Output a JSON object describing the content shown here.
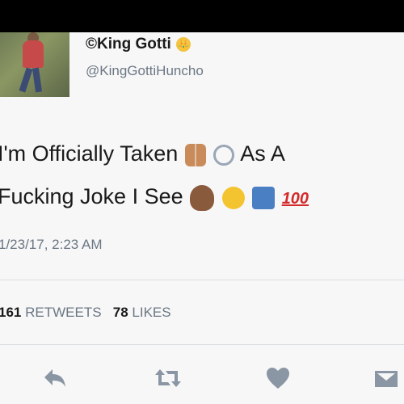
{
  "tweet": {
    "display_name": "©King Gotti",
    "crown_icon": "crown-face-icon",
    "handle": "@KingGottiHuncho",
    "text_line1_before": "I'm Officially Taken",
    "text_line1_after": "As A",
    "text_line2_before": "Fucking Joke I See",
    "emoji_100": "100",
    "emojis": [
      "couple-emoji",
      "ring-emoji",
      "facepalm-emoji",
      "tears-of-joy-emoji",
      "restroom-sign-emoji",
      "hundred-points-emoji"
    ],
    "timestamp": "1/23/17, 2:23 AM"
  },
  "stats": {
    "retweets_count": "161",
    "retweets_label": "RETWEETS",
    "likes_count": "78",
    "likes_label": "LIKES"
  },
  "actions": [
    "reply-icon",
    "retweet-icon",
    "like-icon",
    "direct-message-icon"
  ],
  "colors": {
    "background": "#f7f7f8",
    "text": "#1a1a1a",
    "muted": "#6b7783",
    "icon": "#8a96a3"
  }
}
